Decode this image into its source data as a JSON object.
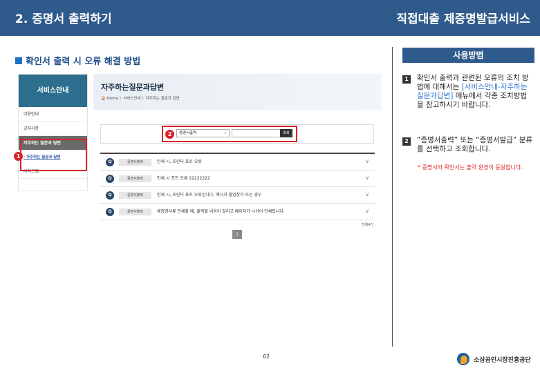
{
  "header": {
    "left_title": "2. 증명서 출력하기",
    "right_title": "직접대출 제증명발급서비스"
  },
  "section_title": "확인서 출력 시 오류 해결 방법",
  "shot": {
    "sidebar": {
      "title": "서비스안내",
      "items": [
        "이용안내",
        "공지사항",
        "자주하는 질문과 답변",
        "사이트맵"
      ],
      "sub_item": "· 자주하는 질문과 답변"
    },
    "page_title": "자주하는질문과답변",
    "breadcrumb": "Home 〉서비스안내 〉자주하는 질문과 답변",
    "search": {
      "select_value": "증명서출력",
      "button": "조회"
    },
    "faq": [
      {
        "q": "Q",
        "category": "증명서출력",
        "text": "인쇄 시, 프린터 포트 오류"
      },
      {
        "q": "Q",
        "category": "증명서출력",
        "text": "인쇄 시 포트 오류 22222222"
      },
      {
        "q": "Q",
        "category": "증명서출력",
        "text": "인쇄 시, 프린터 포트 오류입니다. 메시지 팝업창이 뜨는 경우"
      },
      {
        "q": "Q",
        "category": "증명서출력",
        "text": "제증명서류 인쇄할 때, 출력물 내용이 잘리고 페이지가 나뉘어 인쇄됩니다."
      }
    ],
    "total": "전체4건",
    "page": "1",
    "badges": [
      "1",
      "2"
    ]
  },
  "usage": {
    "title": "사용방법",
    "step1_num": "1",
    "step1_a": "확인서 출력과 관련된 오류의 조치 방법에 대해서는 ",
    "step1_link": "[서비스안내-자주하는질문과답변]",
    "step1_b": " 메뉴에서 각종 조치방법을 참고하시기 바랍니다.",
    "step2_num": "2",
    "step2": "“증명서출력” 또는 “증명서발급” 분류를 선택하고 조회합니다.",
    "note": "* 증명서와 확인서는 출력 환경이 동일합니다."
  },
  "footer": {
    "page_number": "62",
    "org_name": "소상공인시장진흥공단"
  },
  "colors": {
    "header_bg": "#2f5a8c",
    "highlight": "#d9242a",
    "link": "#2a6fd0"
  }
}
